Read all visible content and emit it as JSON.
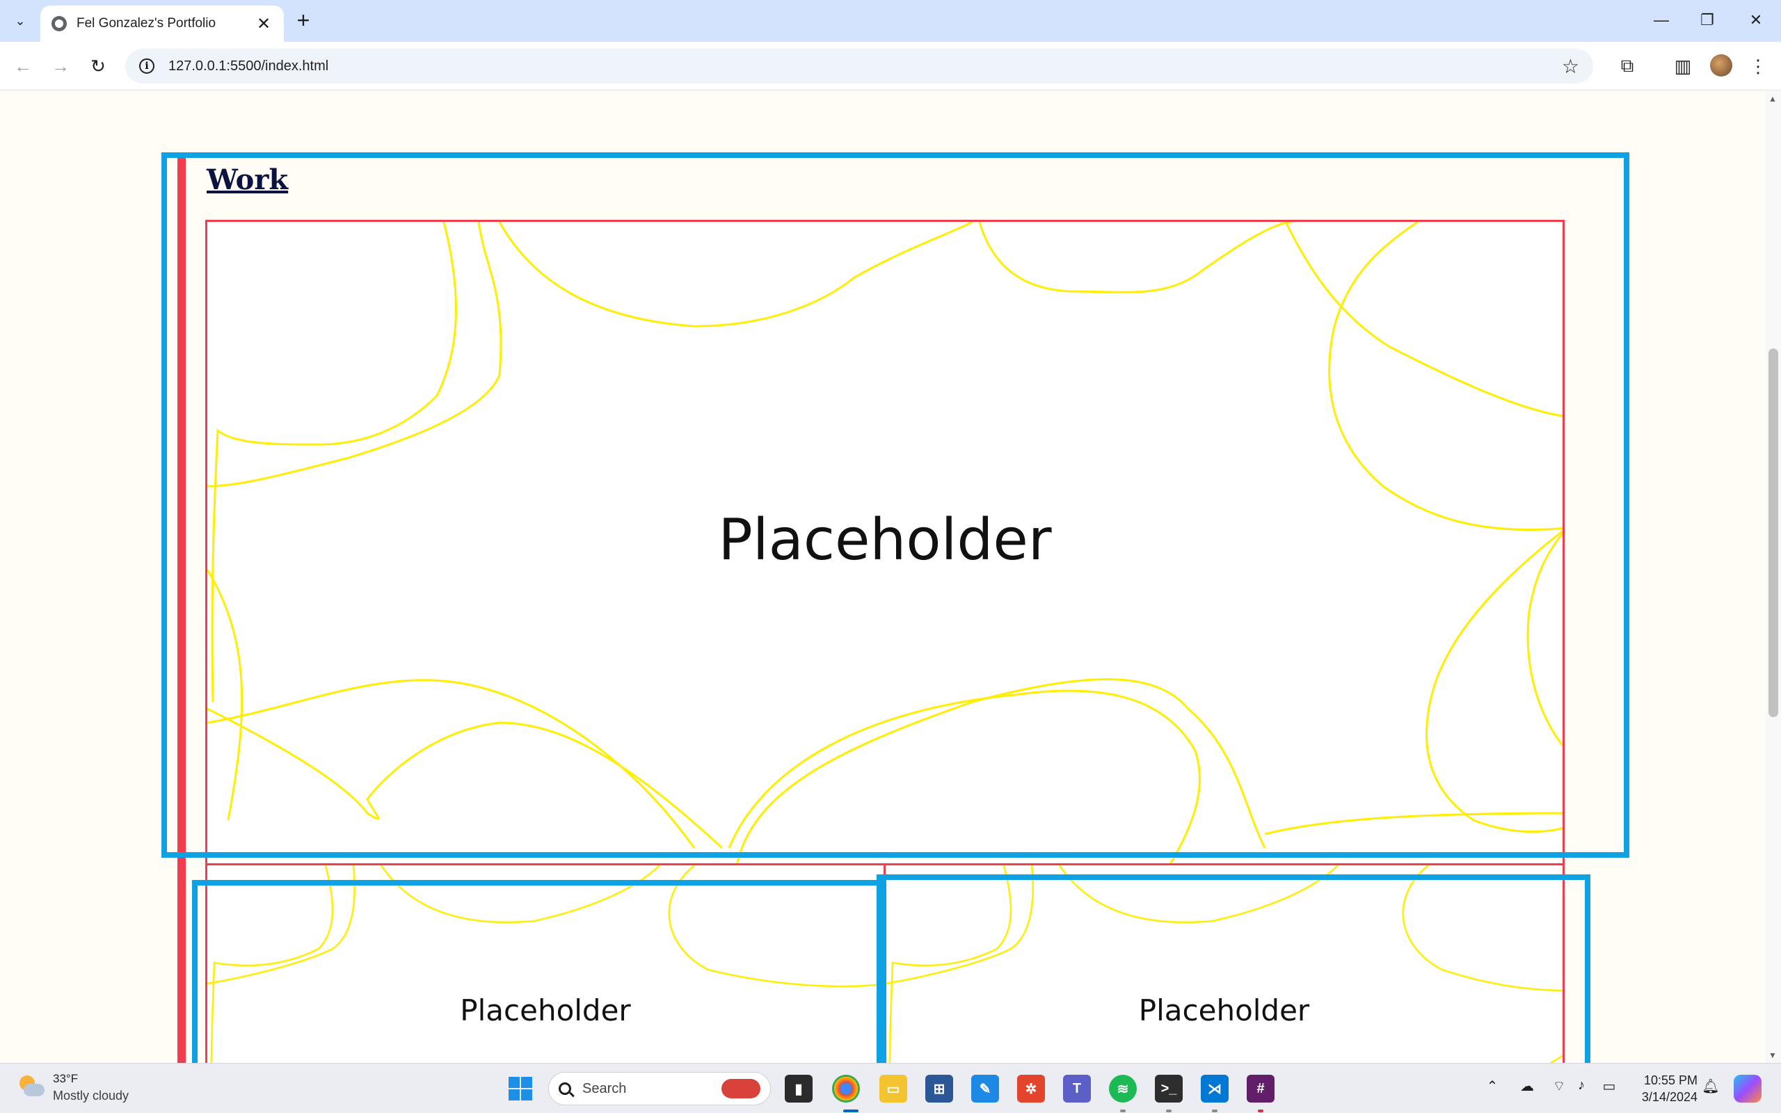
{
  "browser": {
    "tab_title": "Fel Gonzalez's Portfolio",
    "url": "127.0.0.1:5500/index.html",
    "new_tab_symbol": "+",
    "close_symbol": "✕"
  },
  "page": {
    "section_title": "Work",
    "cards": [
      {
        "label": "Placeholder"
      },
      {
        "label": "Placeholder"
      },
      {
        "label": "Placeholder"
      }
    ]
  },
  "taskbar": {
    "weather_temp": "33°F",
    "weather_condition": "Mostly cloudy",
    "search_label": "Search",
    "time": "10:55 PM",
    "date": "3/14/2024"
  },
  "colors": {
    "accent_red": "#f23d4f",
    "overlay_blue": "#0ea2e4",
    "scribble_yellow": "#ffee00",
    "tab_strip": "#d3e3fd"
  },
  "icons": [
    "tab-search-icon",
    "globe-icon",
    "close-icon",
    "plus-icon",
    "minimize-icon",
    "restore-icon",
    "back-icon",
    "forward-icon",
    "reload-icon",
    "info-icon",
    "star-icon",
    "extensions-icon",
    "side-panel-icon",
    "more-icon",
    "windows-start-icon",
    "search-icon",
    "chrome-icon",
    "file-explorer-icon",
    "store-icon",
    "teams-icon",
    "spotify-icon",
    "terminal-icon",
    "vscode-icon",
    "slack-icon",
    "wifi-icon",
    "volume-icon",
    "battery-icon",
    "bell-icon"
  ]
}
